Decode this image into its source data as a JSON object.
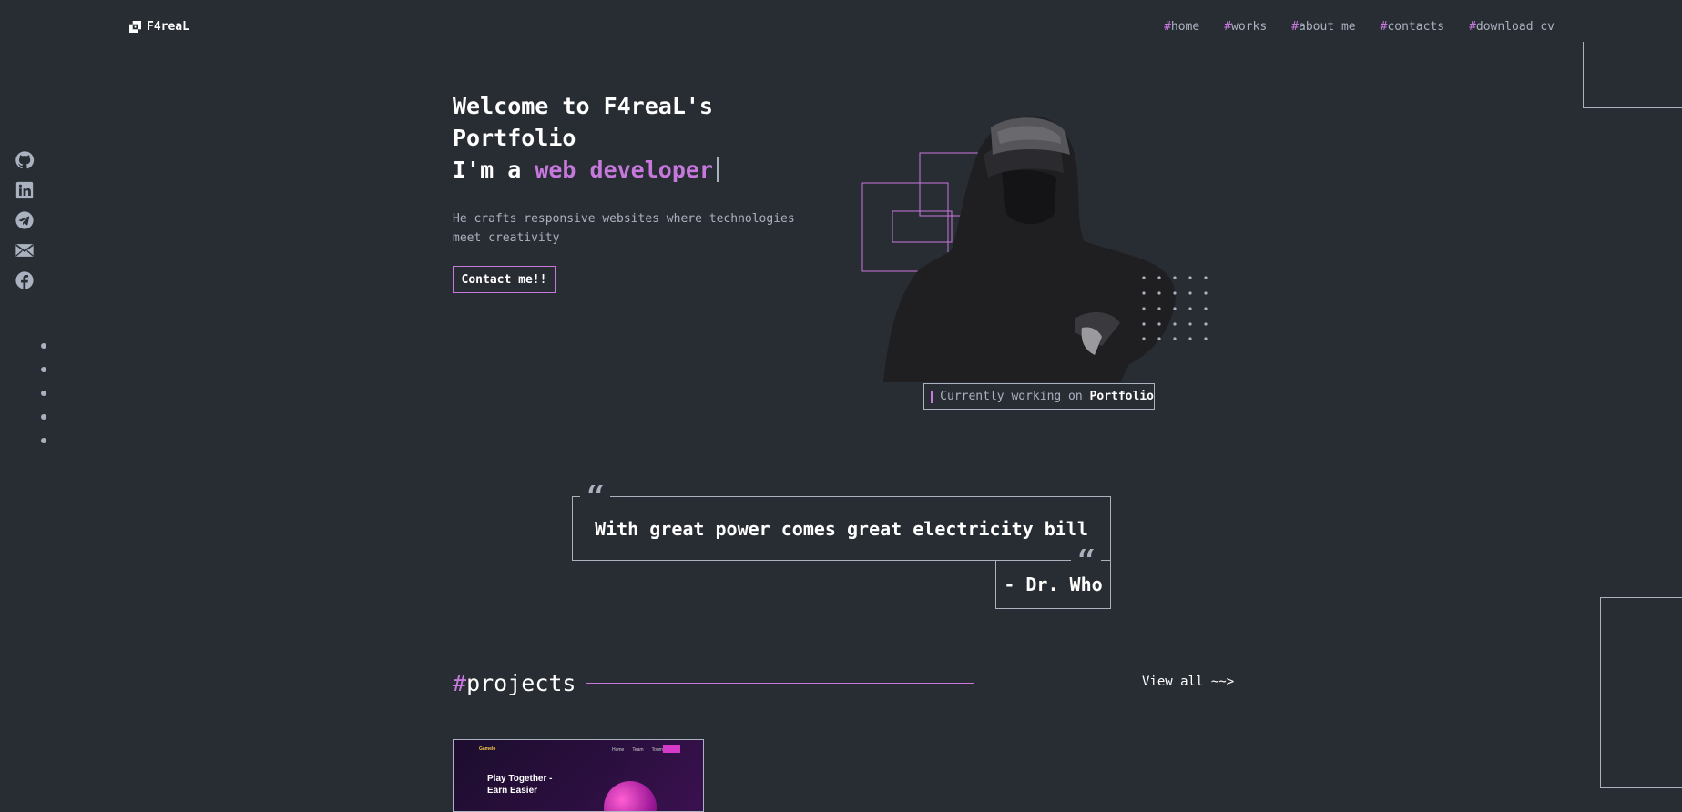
{
  "header": {
    "logo_text": "F4reaL",
    "nav": [
      {
        "hash": "#",
        "label": "home"
      },
      {
        "hash": "#",
        "label": "works"
      },
      {
        "hash": "#",
        "label": "about me"
      },
      {
        "hash": "#",
        "label": "contacts"
      },
      {
        "hash": "#",
        "label": "download cv"
      }
    ]
  },
  "social": [
    "github-icon",
    "linkedin-icon",
    "telegram-icon",
    "email-icon",
    "facebook-icon"
  ],
  "hero": {
    "title_line1": "Welcome to F4reaL's",
    "title_line2": "Portfolio",
    "title_prefix": "I'm a ",
    "title_role": "web developer",
    "description": "He crafts responsive websites where technologies meet creativity",
    "contact_button": "Contact me!!",
    "status_prefix": "Currently working on ",
    "status_project": "Portfolio"
  },
  "quote": {
    "text": "With great power comes great electricity bill",
    "author": "- Dr. Who",
    "mark": "“"
  },
  "projects": {
    "hash": "#",
    "title": "projects",
    "view_all": "View all ~~>",
    "card": {
      "logo": "Gamelo",
      "nav": [
        "Home",
        "Team",
        "Tournaments"
      ],
      "headline_line1": "Play Together -",
      "headline_line2": "Earn Easier"
    }
  },
  "colors": {
    "background": "#282c33",
    "accent": "#c778dd",
    "text": "#abb2bf",
    "heading": "#ffffff"
  }
}
